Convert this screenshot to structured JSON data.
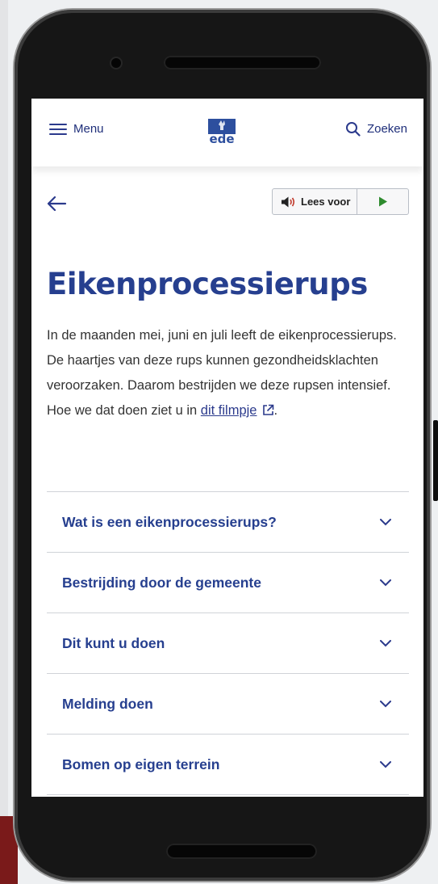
{
  "header": {
    "menu_label": "Menu",
    "logo_text": "ede",
    "search_label": "Zoeken"
  },
  "tools": {
    "read_aloud_label": "Lees voor"
  },
  "page": {
    "title": "Eikenprocessierups",
    "intro_text": "In de maanden mei, juni en juli leeft de eikenprocessierups. De haartjes van deze rups kunnen gezondheidsklachten veroorzaken. Daarom bestrijden we deze rupsen intensief. Hoe we dat doen ziet u in ",
    "intro_link": "dit filmpje",
    "intro_end": "."
  },
  "accordion": [
    {
      "title": "Wat is een eikenprocessierups?"
    },
    {
      "title": "Bestrijding door de gemeente"
    },
    {
      "title": "Dit kunt u doen"
    },
    {
      "title": "Melding doen"
    },
    {
      "title": "Bomen op eigen terrein"
    }
  ],
  "colors": {
    "brand_blue": "#263f8f",
    "play_green": "#2e8b2e",
    "phone_body": "#161616"
  }
}
